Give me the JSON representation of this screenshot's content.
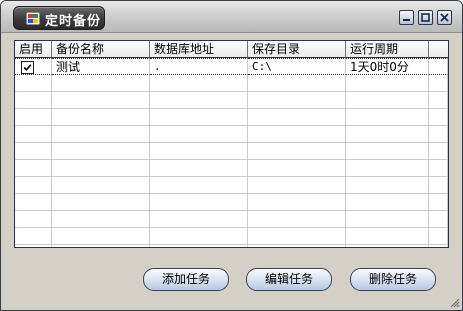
{
  "window": {
    "title": "定时备份"
  },
  "grid": {
    "columns": [
      "启用",
      "备份名称",
      "数据库地址",
      "保存目录",
      "运行周期"
    ],
    "rows": [
      {
        "enabled": true,
        "name": "测试",
        "db_address": ".",
        "save_dir": "C:\\",
        "period": "1天0时0分"
      }
    ]
  },
  "buttons": {
    "add": "添加任务",
    "edit": "编辑任务",
    "delete": "删除任务"
  },
  "icons": {
    "app": "app-window-icon",
    "minimize": "minimize-icon",
    "maximize": "maximize-icon",
    "close": "close-icon",
    "resize": "resize-grip-icon",
    "checkbox": "checkbox-checked-icon"
  }
}
